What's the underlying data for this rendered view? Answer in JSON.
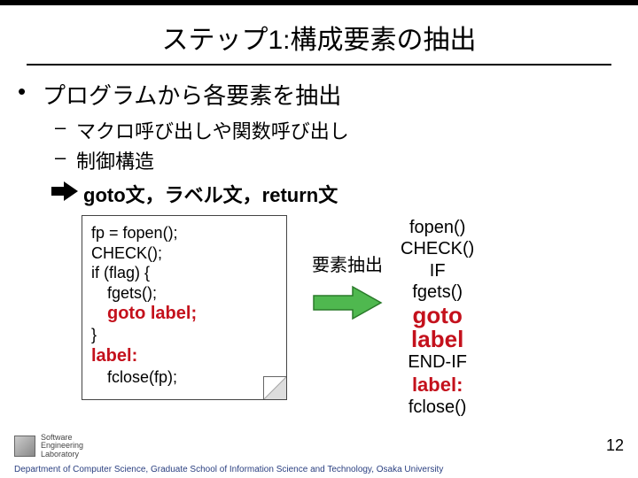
{
  "title": "ステップ1:構成要素の抽出",
  "bullets": {
    "main": "プログラムから各要素を抽出",
    "sub1": "マクロ呼び出しや関数呼び出し",
    "sub2": "制御構造",
    "arrow_line": "goto文，ラベル文，return文"
  },
  "code": {
    "l1": "fp = fopen();",
    "l2": "CHECK();",
    "l3": "if (flag) {",
    "l4": "fgets();",
    "l5": "goto label;",
    "l6": "}",
    "l7": "label:",
    "l8": "fclose(fp);"
  },
  "mid_label": "要素抽出",
  "result": {
    "r1": "fopen()",
    "r2": "CHECK()",
    "r3": "IF",
    "r4": "fgets()",
    "r5a": "goto",
    "r5b": "label",
    "r6": "END-IF",
    "r7": "label:",
    "r8": "fclose()"
  },
  "footer": "Department of Computer Science, Graduate School of Information Science and Technology, Osaka University",
  "logo": {
    "line1": "Software",
    "line2": "Engineering",
    "line3": "Laboratory"
  },
  "slide_number": "12"
}
